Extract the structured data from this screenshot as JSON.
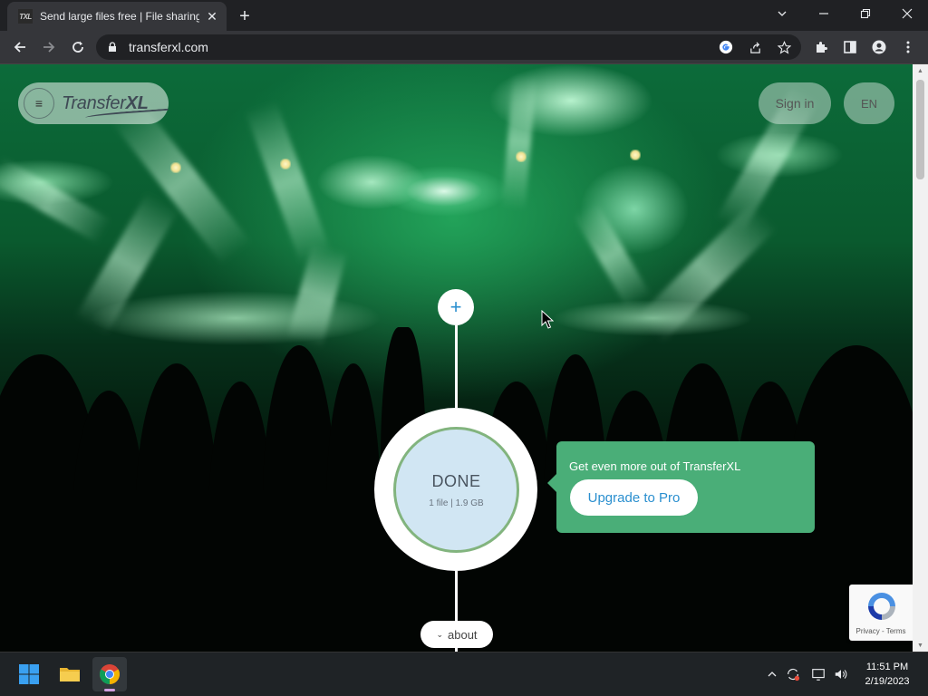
{
  "browser": {
    "tab_title": "Send large files free | File sharing",
    "tab_favicon_text": "TXL",
    "url": "transferxl.com",
    "icons": [
      "back-icon",
      "forward-icon",
      "reload-icon",
      "lock-icon",
      "google-icon",
      "share-icon",
      "star-icon",
      "extensions-icon",
      "side-panel-icon",
      "profile-icon",
      "more-icon"
    ]
  },
  "site": {
    "logo_regular": "Transfer",
    "logo_bold": "XL",
    "sign_in": "Sign in",
    "language": "EN",
    "add_symbol": "+",
    "status": "DONE",
    "file_info": "1 file | 1.9 GB",
    "promo_text": "Get even more out of TransferXL",
    "promo_button": "Upgrade to Pro",
    "about": "about",
    "recaptcha_text": "Privacy - Terms",
    "colors": {
      "accent": "#2a8fcf",
      "promo_bg": "#4aae78",
      "circle_fill": "#d1e6f3"
    }
  },
  "taskbar": {
    "apps": [
      "windows-start-icon",
      "file-explorer-icon",
      "chrome-icon"
    ],
    "time": "11:51 PM",
    "date": "2/19/2023"
  }
}
